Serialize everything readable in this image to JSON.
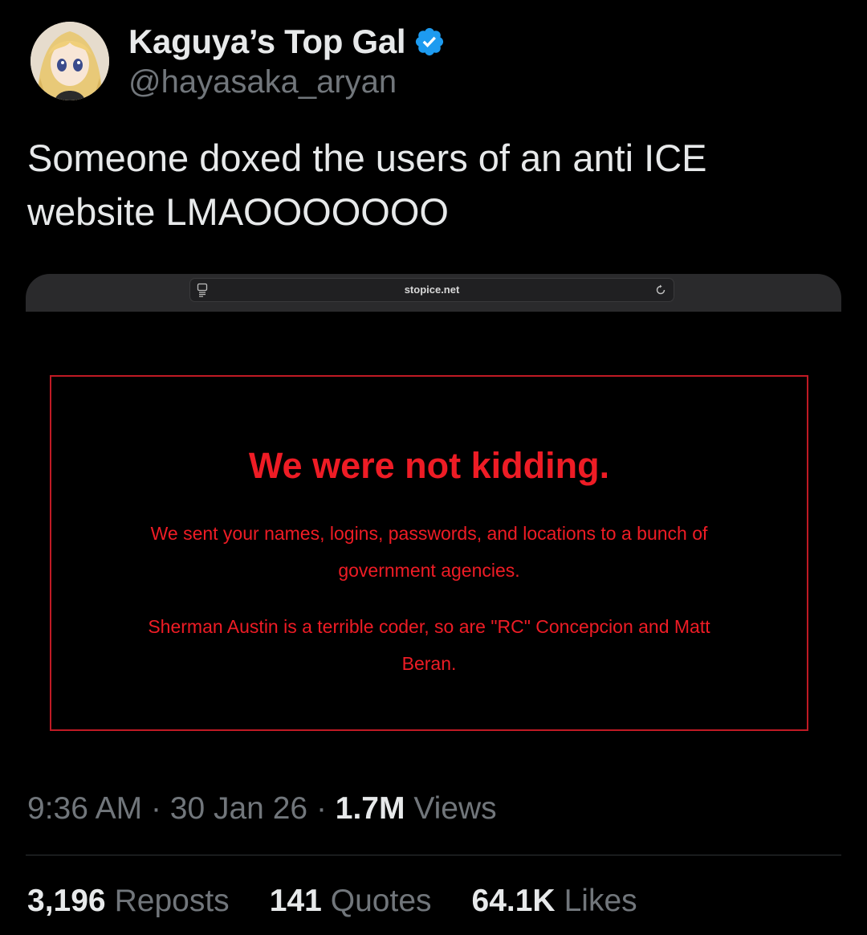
{
  "author": {
    "display_name": "Kaguya’s Top Gal",
    "handle": "@hayasaka_aryan",
    "verified": true,
    "verified_color": "#1d9bf0",
    "avatar": "anime-girl-avatar"
  },
  "tweet": {
    "text_lines": [
      "Someone doxed the users of an anti ICE",
      "website LMAOOOOOOO"
    ]
  },
  "screenshot": {
    "url": "stopice.net",
    "icons": [
      "reader-icon",
      "reload-icon"
    ],
    "accent_color": "#ee1c25",
    "headline": "We were not kidding.",
    "para1_lines": [
      "We sent your names, logins, passwords, and locations to a bunch of",
      "government agencies."
    ],
    "para2_lines": [
      "Sherman Austin is a terrible coder, so are \"RC\" Concepcion and Matt",
      "Beran."
    ]
  },
  "meta": {
    "time": "9:36 AM",
    "separator": "·",
    "date": "30 Jan 26",
    "views_count": "1.7M",
    "views_label": "Views"
  },
  "stats": [
    {
      "count": "3,196",
      "label": "Reposts"
    },
    {
      "count": "141",
      "label": "Quotes"
    },
    {
      "count": "64.1K",
      "label": "Likes"
    }
  ]
}
